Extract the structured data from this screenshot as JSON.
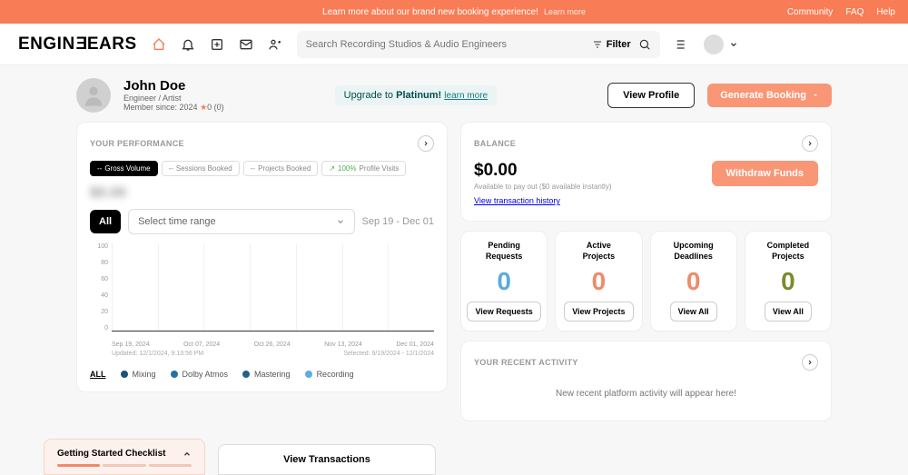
{
  "topbar": {
    "promo_text": "Learn more about our brand new booking experience!",
    "promo_link": "Learn more",
    "links": [
      "Community",
      "FAQ",
      "Help"
    ]
  },
  "logo": "ENGINEEARS",
  "search": {
    "placeholder": "Search Recording Studios & Audio Engineers",
    "filter": "Filter"
  },
  "profile": {
    "name": "John Doe",
    "role": "Engineer / Artist",
    "member": "Member since: 2024",
    "rating": "0 (0)"
  },
  "upgrade": {
    "prefix": "Upgrade to ",
    "plan": "Platinum!",
    "link": "learn more"
  },
  "buttons": {
    "view_profile": "View Profile",
    "generate": "Generate Booking"
  },
  "performance": {
    "title": "YOUR PERFORMANCE",
    "pills": [
      {
        "label": "Gross Volume",
        "active": true
      },
      {
        "label": "Sessions Booked",
        "prefix": "--"
      },
      {
        "label": "Projects Booked",
        "prefix": "--"
      },
      {
        "label": "Profile Visits",
        "prefix": "100%",
        "pct": true
      }
    ],
    "blur": "$0.00",
    "all": "All",
    "select": "Select time range",
    "range": "Sep 19  -  Dec 01",
    "updated": "Updated: 12/1/2024, 9:13:56 PM",
    "selected": "Selected: 9/19/2024 - 12/1/2024",
    "legend_all": "ALL",
    "legend": [
      {
        "label": "Mixing",
        "color": "#1a5276"
      },
      {
        "label": "Dolby Atmos",
        "color": "#2471a3"
      },
      {
        "label": "Mastering",
        "color": "#1f618d"
      },
      {
        "label": "Recording",
        "color": "#5dade2"
      }
    ]
  },
  "chart_data": {
    "type": "line",
    "title": "Gross Volume",
    "xlabel": "",
    "ylabel": "",
    "ylim": [
      0,
      100
    ],
    "yticks": [
      100,
      80,
      60,
      40,
      20,
      0
    ],
    "categories": [
      "Sep 19, 2024",
      "Oct 07, 2024",
      "Oct 26, 2024",
      "Nov 13, 2024",
      "Dec 01, 2024"
    ],
    "series": [
      {
        "name": "Mixing",
        "values": [
          0,
          0,
          0,
          0,
          0
        ]
      },
      {
        "name": "Dolby Atmos",
        "values": [
          0,
          0,
          0,
          0,
          0
        ]
      },
      {
        "name": "Mastering",
        "values": [
          0,
          0,
          0,
          0,
          0
        ]
      },
      {
        "name": "Recording",
        "values": [
          0,
          0,
          0,
          0,
          0
        ]
      }
    ]
  },
  "balance": {
    "title": "BALANCE",
    "amount": "$0.00",
    "sub": "Available to pay out ($0 available instantly)",
    "link": "View transaction history",
    "withdraw": "Withdraw Funds"
  },
  "stats": [
    {
      "label1": "Pending",
      "label2": "Requests",
      "num": "0",
      "color": "blue",
      "btn": "View Requests"
    },
    {
      "label1": "Active",
      "label2": "Projects",
      "num": "0",
      "color": "orange",
      "btn": "View Projects"
    },
    {
      "label1": "Upcoming",
      "label2": "Deadlines",
      "num": "0",
      "color": "orange",
      "btn": "View All"
    },
    {
      "label1": "Completed",
      "label2": "Projects",
      "num": "0",
      "color": "olive",
      "btn": "View All"
    }
  ],
  "activity": {
    "title": "YOUR RECENT ACTIVITY",
    "msg": "New recent platform activity will appear here!"
  },
  "checklist": {
    "title": "Getting Started Checklist"
  },
  "view_trans": "View Transactions"
}
